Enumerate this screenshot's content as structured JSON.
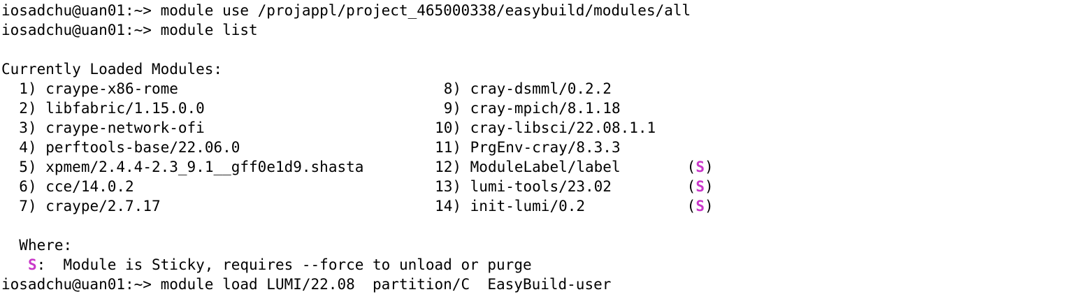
{
  "terminal": {
    "prompt": "iosadchu@uan01:~> ",
    "commands": [
      "module use /projappl/project_465000338/easybuild/modules/all",
      "module list",
      "module load LUMI/22.08  partition/C  EasyBuild-user"
    ],
    "header": "Currently Loaded Modules:",
    "modules_left": [
      {
        "num": "1)",
        "name": "craype-x86-rome"
      },
      {
        "num": "2)",
        "name": "libfabric/1.15.0.0"
      },
      {
        "num": "3)",
        "name": "craype-network-ofi"
      },
      {
        "num": "4)",
        "name": "perftools-base/22.06.0"
      },
      {
        "num": "5)",
        "name": "xpmem/2.4.4-2.3_9.1__gff0e1d9.shasta"
      },
      {
        "num": "6)",
        "name": "cce/14.0.2"
      },
      {
        "num": "7)",
        "name": "craype/2.7.17"
      }
    ],
    "modules_right": [
      {
        "num": "8)",
        "name": "cray-dsmml/0.2.2",
        "flag": ""
      },
      {
        "num": "9)",
        "name": "cray-mpich/8.1.18",
        "flag": ""
      },
      {
        "num": "10)",
        "name": "cray-libsci/22.08.1.1",
        "flag": ""
      },
      {
        "num": "11)",
        "name": "PrgEnv-cray/8.3.3",
        "flag": ""
      },
      {
        "num": "12)",
        "name": "ModuleLabel/label",
        "flag": "S"
      },
      {
        "num": "13)",
        "name": "lumi-tools/23.02",
        "flag": "S"
      },
      {
        "num": "14)",
        "name": "init-lumi/0.2",
        "flag": "S"
      }
    ],
    "where_label": "Where:",
    "legend_flag": "S",
    "legend_text": ":  Module is Sticky, requires --force to unload or purge",
    "colors": {
      "background": "#ffffff",
      "text": "#000000",
      "sticky": "#c837c8"
    }
  }
}
